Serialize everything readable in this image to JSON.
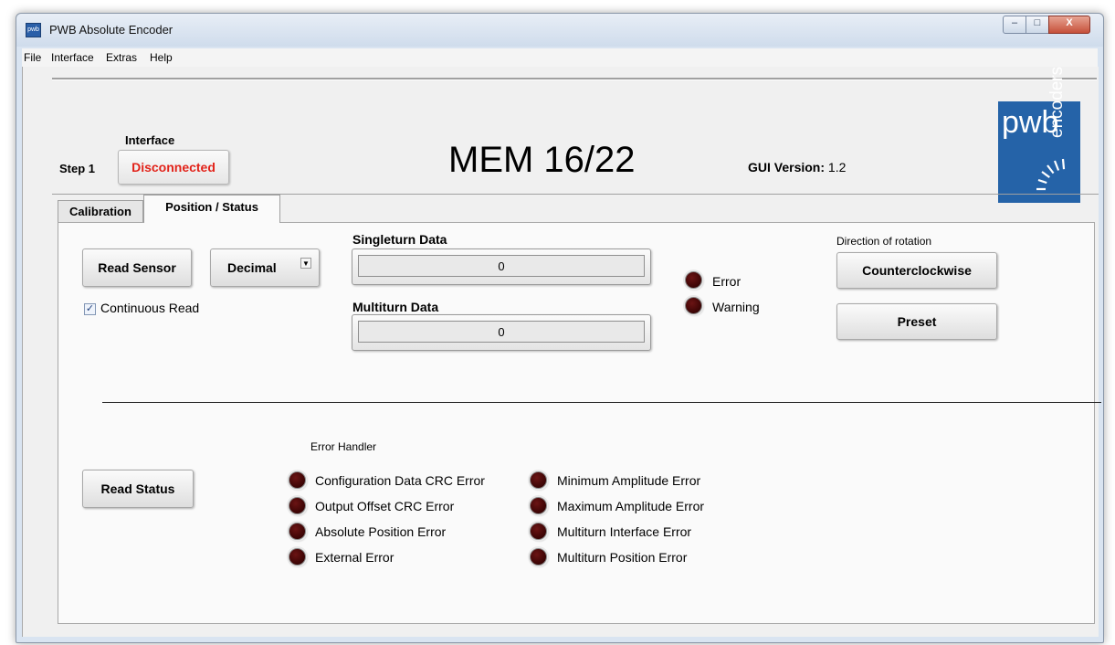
{
  "window": {
    "title": "PWB Absolute Encoder",
    "app_icon_text": "pwb",
    "controls": {
      "minimize": "–",
      "maximize": "□",
      "close": "X"
    }
  },
  "menu": [
    "File",
    "Interface",
    "Extras",
    "Help"
  ],
  "header": {
    "interface_label": "Interface",
    "step_label": "Step 1",
    "connection_status": "Disconnected",
    "model": "MEM 16/22",
    "gui_version_label": "GUI Version:",
    "gui_version_value": "1.2",
    "logo_main": "pwb",
    "logo_side": "encoders"
  },
  "tabs": [
    "Calibration",
    "Position / Status"
  ],
  "position": {
    "read_sensor_label": "Read Sensor",
    "format_select": "Decimal",
    "continuous_read_label": "Continuous Read",
    "continuous_read_checked": true,
    "singleturn_label": "Singleturn Data",
    "singleturn_value": "0",
    "multiturn_label": "Multiturn Data",
    "multiturn_value": "0",
    "error_label": "Error",
    "warning_label": "Warning",
    "direction_label": "Direction of rotation",
    "direction_button": "Counterclockwise",
    "preset_button": "Preset"
  },
  "status": {
    "read_status_label": "Read Status",
    "error_handler_label": "Error Handler",
    "errors_left": [
      "Configuration Data CRC Error",
      "Output Offset CRC Error",
      "Absolute Position Error",
      "External Error"
    ],
    "errors_right": [
      "Minimum Amplitude Error",
      "Maximum Amplitude Error",
      "Multiturn Interface Error",
      "Multiturn Position Error"
    ]
  },
  "colors": {
    "led_off": "#3a0404",
    "disconnected_text": "#e2231a",
    "logo_blue": "#2563a8"
  }
}
